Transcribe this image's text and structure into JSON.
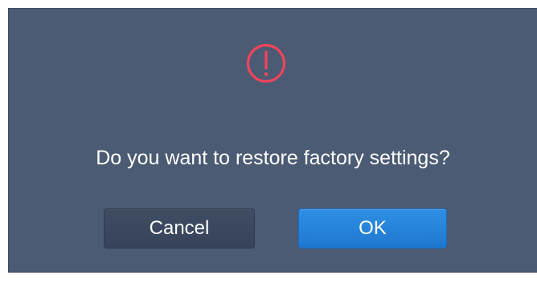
{
  "dialog": {
    "icon": "warning-exclamation-icon",
    "icon_color": "#f0445a",
    "message": "Do you want to restore factory settings?",
    "cancel_label": "Cancel",
    "ok_label": "OK",
    "background_color": "#4b5b74",
    "ok_color": "#2a86dd"
  }
}
